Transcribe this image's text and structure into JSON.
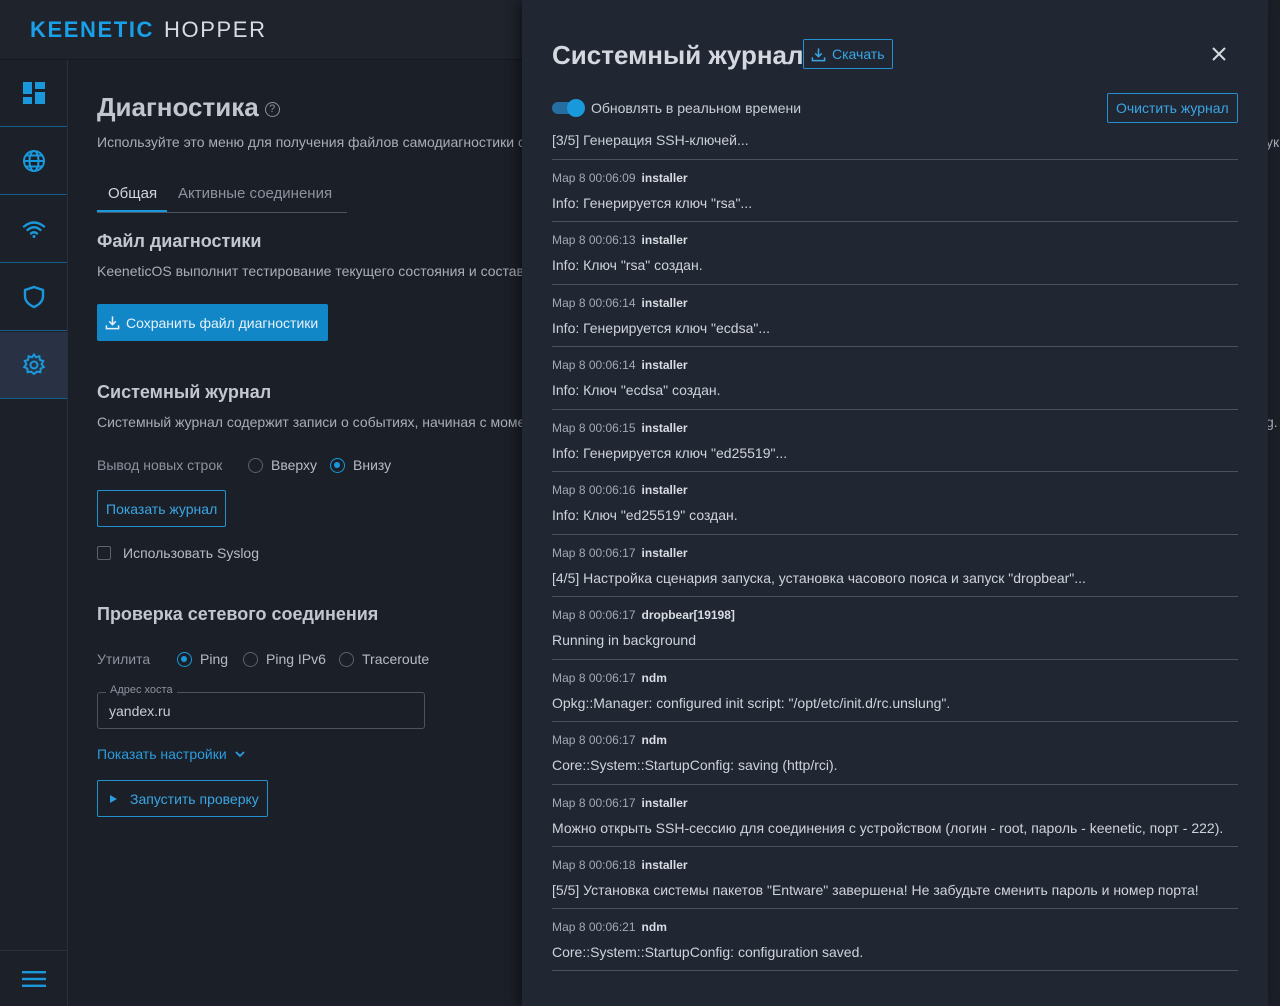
{
  "brand": {
    "left": "KEENETIC",
    "right": "HOPPER"
  },
  "sidebar": {
    "items": [
      {
        "name": "dashboard-icon"
      },
      {
        "name": "globe-icon"
      },
      {
        "name": "wifi-icon"
      },
      {
        "name": "shield-icon"
      },
      {
        "name": "gear-icon"
      }
    ],
    "menu": "menu-icon"
  },
  "main": {
    "title": "Диагностика",
    "help": "?",
    "intro": "Используйте это меню для получения файлов самодиагностики сист",
    "tabs": [
      "Общая",
      "Активные соединения"
    ],
    "diag_file": {
      "title": "Файл диагностики",
      "desc": "KeeneticOS выполнит тестирование текущего состояния и составит д",
      "button": "Сохранить файл диагностики"
    },
    "syslog": {
      "title": "Системный журнал",
      "desc": "Системный журнал содержит записи о событиях, начиная с момента",
      "output_label": "Вывод новых строк",
      "opt_top": "Вверху",
      "opt_bottom": "Внизу",
      "show_button": "Показать журнал",
      "use_syslog": "Использовать Syslog"
    },
    "netcheck": {
      "title": "Проверка сетевого соединения",
      "utility_label": "Утилита",
      "opt_ping": "Ping",
      "opt_ping6": "Ping IPv6",
      "opt_trace": "Traceroute",
      "host_label": "Адрес хоста",
      "host_value": "yandex.ru",
      "show_settings": "Показать настройки",
      "run_button": "Запустить проверку"
    },
    "strip": {
      "line1": "ук",
      "line2": "g."
    }
  },
  "panel": {
    "title": "Системный журнал",
    "download": "Скачать",
    "realtime": "Обновлять в реальном времени",
    "clear": "Очистить журнал",
    "first_line": "[3/5] Генерация SSH-ключей...",
    "entries": [
      {
        "time": "Мар 8 00:06:09",
        "src": "installer",
        "msg": "Info: Генерируется ключ \"rsa\"..."
      },
      {
        "time": "Мар 8 00:06:13",
        "src": "installer",
        "msg": "Info: Ключ \"rsa\" создан."
      },
      {
        "time": "Мар 8 00:06:14",
        "src": "installer",
        "msg": "Info: Генерируется ключ \"ecdsa\"..."
      },
      {
        "time": "Мар 8 00:06:14",
        "src": "installer",
        "msg": "Info: Ключ \"ecdsa\" создан."
      },
      {
        "time": "Мар 8 00:06:15",
        "src": "installer",
        "msg": "Info: Генерируется ключ \"ed25519\"..."
      },
      {
        "time": "Мар 8 00:06:16",
        "src": "installer",
        "msg": "Info: Ключ \"ed25519\" создан."
      },
      {
        "time": "Мар 8 00:06:17",
        "src": "installer",
        "msg": "[4/5] Настройка сценария запуска, установка часового пояса и запуск \"dropbear\"..."
      },
      {
        "time": "Мар 8 00:06:17",
        "src": "dropbear[19198]",
        "msg": "Running in background"
      },
      {
        "time": "Мар 8 00:06:17",
        "src": "ndm",
        "msg": "Opkg::Manager: configured init script: \"/opt/etc/init.d/rc.unslung\"."
      },
      {
        "time": "Мар 8 00:06:17",
        "src": "ndm",
        "msg": "Core::System::StartupConfig: saving (http/rci)."
      },
      {
        "time": "Мар 8 00:06:17",
        "src": "installer",
        "msg": "Можно открыть SSH-сессию для соединения с устройством (логин - root, пароль - keenetic, порт - 222)."
      },
      {
        "time": "Мар 8 00:06:18",
        "src": "installer",
        "msg": "[5/5] Установка системы пакетов \"Entware\" завершена! Не забудьте сменить пароль и номер порта!"
      },
      {
        "time": "Мар 8 00:06:21",
        "src": "ndm",
        "msg": "Core::System::StartupConfig: configuration saved."
      }
    ]
  },
  "colors": {
    "accent": "#1a98dc",
    "button": "#1287c8",
    "panel_bg": "#212633",
    "page_bg": "#1b1f27"
  }
}
